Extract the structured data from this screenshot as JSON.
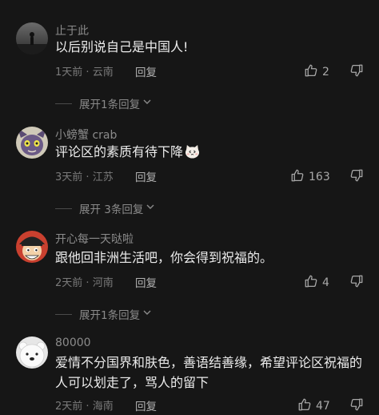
{
  "comments": [
    {
      "username": "止于此",
      "text": "以后别说自己是中国人!",
      "time": "1天前",
      "location": "云南",
      "reply_label": "回复",
      "likes": "2",
      "expand_label": "展开1条回复"
    },
    {
      "username": "小螃蟹 crab",
      "text": "评论区的素质有待下降",
      "time": "3天前",
      "location": "江苏",
      "reply_label": "回复",
      "likes": "163",
      "expand_label": "展开 3条回复"
    },
    {
      "username": "开心每一天哒啦",
      "text": "跟他回非洲生活吧，你会得到祝福的。",
      "time": "2天前",
      "location": "河南",
      "reply_label": "回复",
      "likes": "4",
      "expand_label": "展开1条回复"
    },
    {
      "username": "80000",
      "text": "爱情不分国界和肤色，善语结善缘，希望评论区祝福的人可以划走了，骂人的留下",
      "time": "2天前",
      "location": "海南",
      "reply_label": "回复",
      "likes": "47"
    }
  ],
  "meta_separator": "·",
  "icons": {
    "like": "thumbs-up-icon",
    "dislike": "thumbs-down-icon",
    "expand": "chevron-down-icon",
    "emoji": "cat-face-emoji"
  },
  "colors": {
    "background": "#161616",
    "text_primary": "#ececec",
    "text_secondary": "#8b8b8b"
  }
}
